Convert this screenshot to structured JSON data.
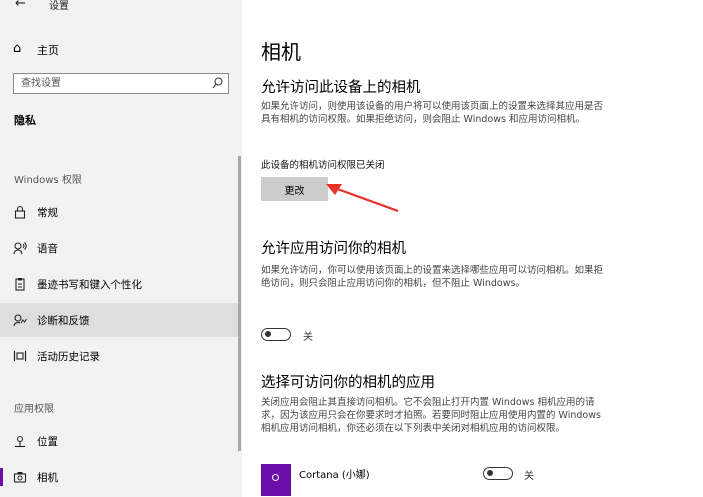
{
  "window": {
    "title": "设置"
  },
  "sidebar": {
    "home_label": "主页",
    "search_placeholder": "查找设置",
    "section_title": "隐私",
    "group1_label": "Windows 权限",
    "group1_items": [
      {
        "label": "常规",
        "icon": "lock-icon"
      },
      {
        "label": "语音",
        "icon": "speech-icon"
      },
      {
        "label": "墨迹书写和键入个性化",
        "icon": "clipboard-icon"
      },
      {
        "label": "诊断和反馈",
        "icon": "diagnostics-icon",
        "selected": true
      },
      {
        "label": "活动历史记录",
        "icon": "history-icon"
      }
    ],
    "group2_label": "应用权限",
    "group2_items": [
      {
        "label": "位置",
        "icon": "location-icon"
      },
      {
        "label": "相机",
        "icon": "camera-icon",
        "active": true
      }
    ]
  },
  "main": {
    "title": "相机",
    "device_access": {
      "heading": "允许访问此设备上的相机",
      "description": "如果允许访问，则使用该设备的用户将可以使用该页面上的设置来选择其应用是否具有相机的访问权限。如果拒绝访问，则会阻止 Windows 和应用访问相机。",
      "status": "此设备的相机访问权限已关闭",
      "change_button": "更改"
    },
    "app_access": {
      "heading": "允许应用访问你的相机",
      "description": "如果允许访问，你可以使用该页面上的设置来选择哪些应用可以访问相机。如果拒绝访问，则只会阻止应用访问你的相机，但不阻止 Windows。",
      "toggle_label": "关",
      "toggle_on": false
    },
    "choose_apps": {
      "heading": "选择可访问你的相机的应用",
      "description": "关闭应用会阻止其直接访问相机。它不会阻止打开内置 Windows 相机应用的请求，因为该应用只会在你要求时才拍照。若要同时阻止应用使用内置的 Windows 相机应用访问相机，你还必须在以下列表中关闭对相机应用的访问权限。",
      "apps": [
        {
          "name": "Cortana (小娜)",
          "toggle_label": "关",
          "toggle_on": false,
          "tile_color": "#6b0fa8"
        }
      ]
    }
  },
  "colors": {
    "accent": "#6b0fa8",
    "sidebar_bg": "#f2f2f2",
    "button_bg": "#cccccc",
    "annotation_arrow": "#e8302a"
  }
}
